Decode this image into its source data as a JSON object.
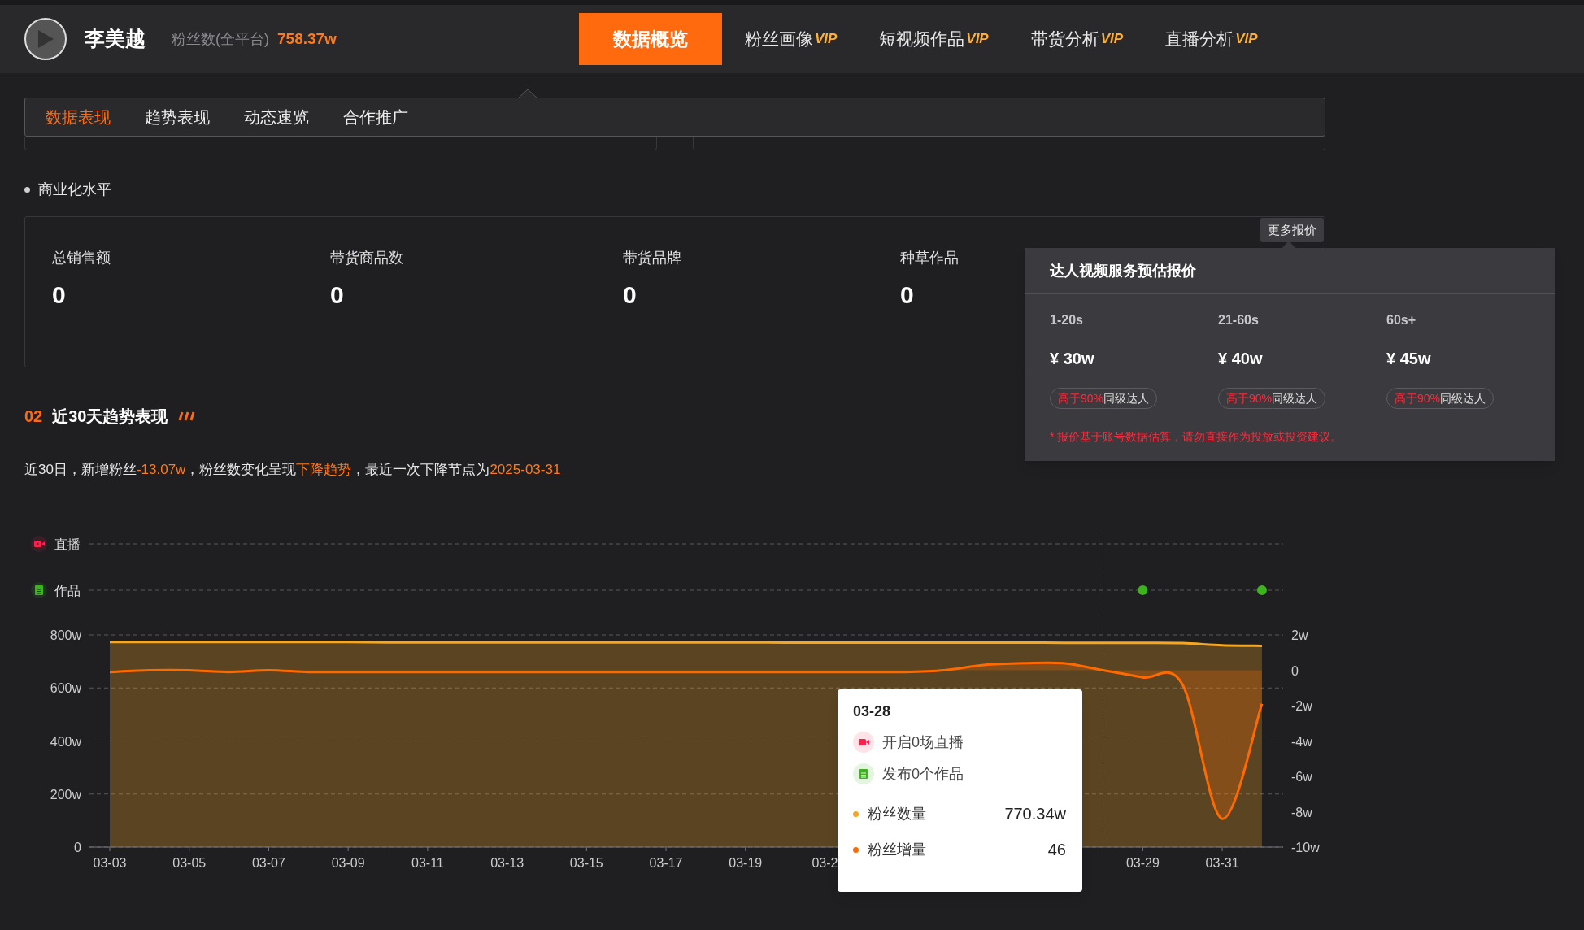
{
  "header": {
    "name": "李美越",
    "fans_label": "粉丝数(全平台)",
    "fans_value": "758.37w",
    "nav": [
      {
        "label": "数据概览",
        "selected": true
      },
      {
        "label": "粉丝画像",
        "badge": "VIP",
        "selected": false
      },
      {
        "label": "短视频作品",
        "badge": "VIP",
        "selected": false
      },
      {
        "label": "带货分析",
        "badge": "VIP",
        "selected": false
      },
      {
        "label": "直播分析",
        "badge": "VIP",
        "selected": false
      }
    ]
  },
  "subtabs": [
    {
      "label": "数据表现",
      "selected": true
    },
    {
      "label": "趋势表现",
      "selected": false
    },
    {
      "label": "动态速览",
      "selected": false
    },
    {
      "label": "合作推广",
      "selected": false
    }
  ],
  "commerce": {
    "title": "商业化水平",
    "more_button": "更多报价",
    "metrics": [
      {
        "label": "总销售额",
        "value": "0"
      },
      {
        "label": "带货商品数",
        "value": "0"
      },
      {
        "label": "带货品牌",
        "value": "0"
      },
      {
        "label": "种草作品",
        "value": "0"
      }
    ],
    "quote_popover": {
      "title": "达人视频服务预估报价",
      "columns": [
        {
          "duration": "1-20s",
          "price": "¥ 30w",
          "highlight": "高于90%",
          "compare": "同级达人"
        },
        {
          "duration": "21-60s",
          "price": "¥ 40w",
          "highlight": "高于90%",
          "compare": "同级达人"
        },
        {
          "duration": "60s+",
          "price": "¥ 45w",
          "highlight": "高于90%",
          "compare": "同级达人"
        }
      ],
      "note": "* 报价基于账号数据估算，请勿直接作为投放或投资建议。"
    }
  },
  "trend": {
    "number": "02",
    "title": "近30天趋势表现",
    "summary": [
      {
        "text": "近30日，新增粉丝",
        "highlight": false
      },
      {
        "text": "-13.07w",
        "highlight": true
      },
      {
        "text": "，粉丝数变化呈现",
        "highlight": false
      },
      {
        "text": "下降趋势",
        "highlight": true
      },
      {
        "text": "，最近一次下降节点为",
        "highlight": false
      },
      {
        "text": "2025-03-31",
        "highlight": true
      }
    ],
    "lanes": [
      {
        "label": "直播",
        "kind": "live"
      },
      {
        "label": "作品",
        "kind": "works"
      }
    ],
    "fans_total": {
      "chart_data": {
        "type": "area",
        "grid": true,
        "categories": [
          "03-03",
          null,
          "03-05",
          null,
          "03-07",
          null,
          "03-09",
          null,
          "03-11",
          null,
          "03-13",
          null,
          "03-15",
          null,
          "03-17",
          null,
          "03-19",
          null,
          "03-2",
          null,
          null,
          null,
          null,
          null,
          null,
          null,
          "03-29",
          null,
          "03-31",
          null
        ],
        "series": [
          {
            "name": "粉丝数量",
            "color": "#f5a623",
            "values": [
              773,
              773,
              773,
              773,
              773,
              773,
              773,
              772,
              772,
              772,
              772,
              772,
              772,
              772,
              772,
              772,
              772,
              771,
              771,
              771,
              771,
              771,
              771,
              771,
              770,
              770,
              770,
              769,
              761,
              759
            ]
          }
        ],
        "ylim": [
          0,
          800
        ],
        "yticks": [
          {
            "value": 0,
            "label": "0"
          },
          {
            "value": 200,
            "label": "200w"
          },
          {
            "value": 400,
            "label": "400w"
          },
          {
            "value": 600,
            "label": "600w"
          },
          {
            "value": 800,
            "label": "800w"
          }
        ]
      }
    },
    "fans_growth": {
      "chart_data": {
        "type": "line",
        "series": [
          {
            "name": "粉丝增量",
            "color": "#ff6a00",
            "values": [
              -0.1,
              0,
              0,
              -0.1,
              0,
              -0.1,
              -0.1,
              -0.1,
              -0.1,
              -0.1,
              -0.1,
              -0.1,
              -0.1,
              -0.1,
              -0.1,
              -0.1,
              -0.1,
              -0.1,
              -0.1,
              -0.1,
              -0.1,
              0,
              0.3,
              0.4,
              0.4,
              0,
              -0.4,
              -0.8,
              -8.4,
              -1.9
            ]
          }
        ],
        "ylim": [
          -10,
          2
        ],
        "yticks": [
          {
            "value": -10,
            "label": "-10w"
          },
          {
            "value": -8,
            "label": "-8w"
          },
          {
            "value": -6,
            "label": "-6w"
          },
          {
            "value": -4,
            "label": "-4w"
          },
          {
            "value": -2,
            "label": "-2w"
          },
          {
            "value": 0,
            "label": "0"
          },
          {
            "value": 2,
            "label": "2w"
          }
        ]
      }
    },
    "tooltip": {
      "date": "03-28",
      "live_text": "开启0场直播",
      "works_text": "发布0个作品",
      "rows": [
        {
          "value": "770.34w"
        },
        {
          "value": "46"
        }
      ]
    }
  }
}
